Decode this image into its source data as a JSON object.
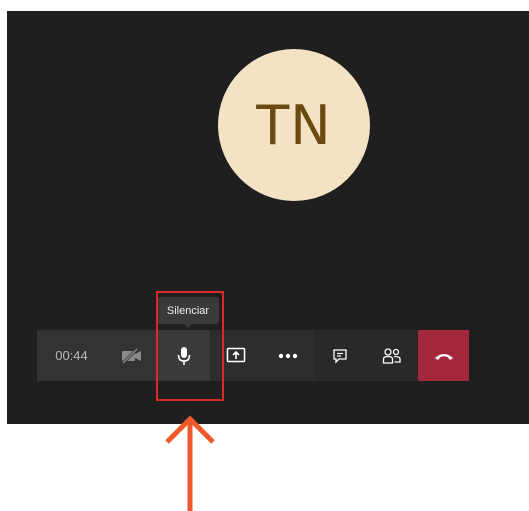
{
  "avatar": {
    "initials": "TN",
    "bg_color": "#f4e2c4",
    "text_color": "#6b4a12"
  },
  "toolbar": {
    "timer": "00:44",
    "camera_icon": "video-off-icon",
    "mic_icon": "microphone-icon",
    "share_icon": "share-screen-icon",
    "more_icon": "more-options-icon",
    "chat_icon": "chat-icon",
    "people_icon": "participants-icon",
    "hangup_icon": "hang-up-icon",
    "hangup_color": "#a4283c"
  },
  "tooltip": {
    "text": "Silenciar"
  },
  "annotation": {
    "highlight_color": "#d92a2a",
    "arrow_color": "#f05a2a"
  }
}
